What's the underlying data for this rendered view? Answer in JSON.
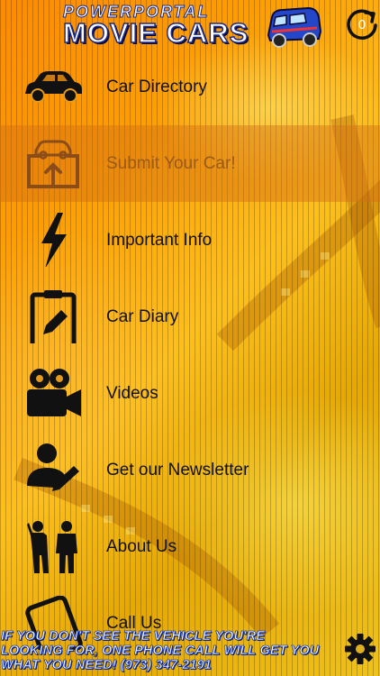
{
  "header": {
    "logo_top": "POWERPORTAL",
    "logo_main": "MOVIE CARS",
    "refresh_count": "0"
  },
  "menu": {
    "items": [
      {
        "label": "Car Directory",
        "icon": "car-icon"
      },
      {
        "label": "Submit Your Car!",
        "icon": "car-upload-icon",
        "selected": true
      },
      {
        "label": "Important Info",
        "icon": "lightning-icon"
      },
      {
        "label": "Car Diary",
        "icon": "clipboard-edit-icon"
      },
      {
        "label": "Videos",
        "icon": "video-camera-icon"
      },
      {
        "label": "Get our Newsletter",
        "icon": "user-edit-icon"
      },
      {
        "label": "About Us",
        "icon": "people-icon"
      },
      {
        "label": "Call Us",
        "icon": "phone-icon"
      }
    ]
  },
  "footer": {
    "banner_text": "IF YOU DON'T SEE THE VEHICLE YOU'RE LOOKING FOR, ONE PHONE CALL WILL GET YOU WHAT YOU NEED!   (973) 347-2191"
  },
  "colors": {
    "background": "#ff9d00",
    "selected_row": "#d26e14",
    "logo_outline": "#1a2a8a",
    "icon": "#111111"
  }
}
